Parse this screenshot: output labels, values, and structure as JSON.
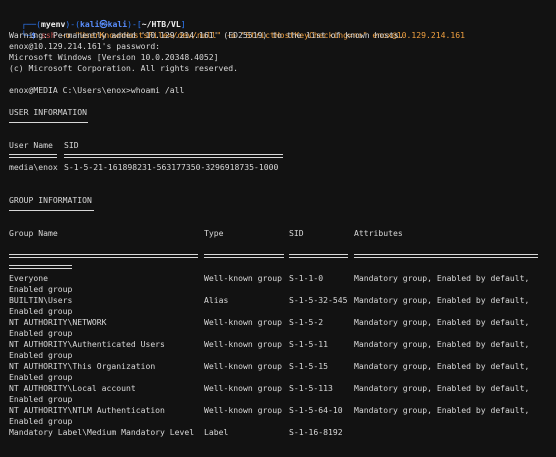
{
  "prompt": {
    "env": "myenv",
    "user": "kali",
    "host": "kali",
    "path": "~/HTB/VL",
    "command_name": "ssh",
    "command_args": "-o \"UserKnownHostsFile=/dev/null\" -o \"StrictHostKeyChecking=no\" enox@10.129.214.161"
  },
  "lines": {
    "warning": "Warning: Permanently added '10.129.214.161' (ED25519) to the list of known hosts.",
    "password": "enox@10.129.214.161's password:",
    "windows": "Microsoft Windows [Version 10.0.20348.4052]",
    "copyright": "(c) Microsoft Corporation. All rights reserved.",
    "cmd_prompt": "enox@MEDIA C:\\Users\\enox>whoami /all"
  },
  "user_info": {
    "title": "USER INFORMATION",
    "headers": {
      "user": "User Name",
      "sid": "SID"
    },
    "row": {
      "user": "media\\enox",
      "sid": "S-1-5-21-161898231-563177350-3296918735-1000"
    }
  },
  "group_info": {
    "title": "GROUP INFORMATION",
    "headers": {
      "group": "Group Name",
      "type": "Type",
      "sid": "SID",
      "attributes": "Attributes"
    },
    "rows": [
      {
        "group": "Everyone",
        "type": "Well-known group",
        "sid": "S-1-1-0",
        "attributes": "Mandatory group, Enabled by default,",
        "cont": "Enabled group"
      },
      {
        "group": "BUILTIN\\Users",
        "type": "Alias",
        "sid": "S-1-5-32-545",
        "attributes": "Mandatory group, Enabled by default,",
        "cont": "Enabled group"
      },
      {
        "group": "NT AUTHORITY\\NETWORK",
        "type": "Well-known group",
        "sid": "S-1-5-2",
        "attributes": "Mandatory group, Enabled by default,",
        "cont": "Enabled group"
      },
      {
        "group": "NT AUTHORITY\\Authenticated Users",
        "type": "Well-known group",
        "sid": "S-1-5-11",
        "attributes": "Mandatory group, Enabled by default,",
        "cont": "Enabled group"
      },
      {
        "group": "NT AUTHORITY\\This Organization",
        "type": "Well-known group",
        "sid": "S-1-5-15",
        "attributes": "Mandatory group, Enabled by default,",
        "cont": "Enabled group"
      },
      {
        "group": "NT AUTHORITY\\Local account",
        "type": "Well-known group",
        "sid": "S-1-5-113",
        "attributes": "Mandatory group, Enabled by default,",
        "cont": "Enabled group"
      },
      {
        "group": "NT AUTHORITY\\NTLM Authentication",
        "type": "Well-known group",
        "sid": "S-1-5-64-10",
        "attributes": "Mandatory group, Enabled by default,",
        "cont": "Enabled group"
      },
      {
        "group": "Mandatory Label\\Medium Mandatory Level",
        "type": "Label",
        "sid": "S-1-16-8192",
        "attributes": "",
        "cont": ""
      }
    ]
  },
  "colors": {
    "background": "#121212",
    "text": "#d8d8d8",
    "prompt_blue": "#2f7dff",
    "command_red": "#c84f4f",
    "string_orange": "#f0a040"
  }
}
